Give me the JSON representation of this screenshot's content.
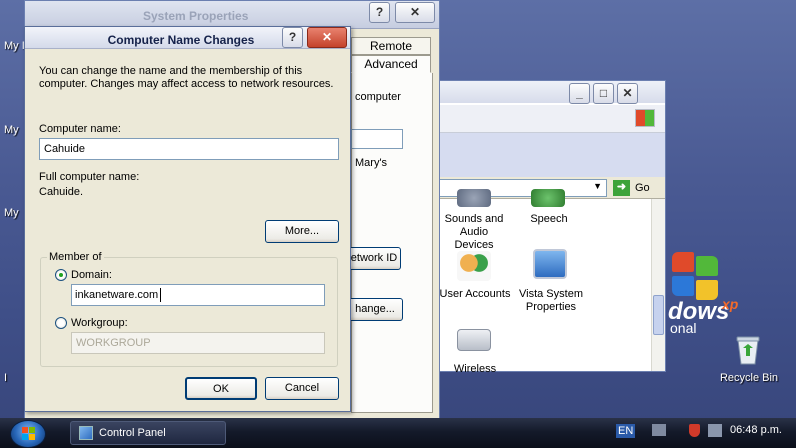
{
  "desktop": {
    "left_icon_labels": [
      "My I",
      "My",
      "My",
      "I"
    ],
    "recycle_bin_label": "Recycle Bin",
    "xp_logo_text": "dows",
    "xp_logo_sup": "xp",
    "xp_logo_sub": "onal"
  },
  "system_properties": {
    "title": "System Properties",
    "help_button": "?",
    "close_button": "✕",
    "tabs": [
      "Remote",
      "Advanced"
    ],
    "text_computer": "computer",
    "text_marys": "Mary's",
    "network_id_button": "etwork ID",
    "change_button": "hange..."
  },
  "control_panel": {
    "address_go": "Go",
    "items": [
      {
        "label": "Sounds and Audio Devices",
        "icon": "speaker-icon"
      },
      {
        "label": "Speech",
        "icon": "speech-icon"
      },
      {
        "label": "User Accounts",
        "icon": "users-icon"
      },
      {
        "label": "Vista System Properties",
        "icon": "computer-icon"
      },
      {
        "label": "Wireless",
        "icon": "wireless-icon"
      }
    ]
  },
  "dialog": {
    "title": "Computer Name Changes",
    "help_button": "?",
    "close_button": "✕",
    "intro": "You can change the name and the membership of this computer. Changes may affect access to network resources.",
    "computer_name_label": "Computer name:",
    "computer_name_value": "Cahuide",
    "full_name_label": "Full computer name:",
    "full_name_value": "Cahuide.",
    "more_button": "More...",
    "member_of_label": "Member of",
    "domain_label": "Domain:",
    "domain_value": "inkanetware.com",
    "workgroup_label": "Workgroup:",
    "workgroup_value": "WORKGROUP",
    "selected": "domain",
    "ok_button": "OK",
    "cancel_button": "Cancel"
  },
  "taskbar": {
    "task_label": "Control Panel",
    "language": "EN",
    "clock": "06:48 p.m."
  }
}
